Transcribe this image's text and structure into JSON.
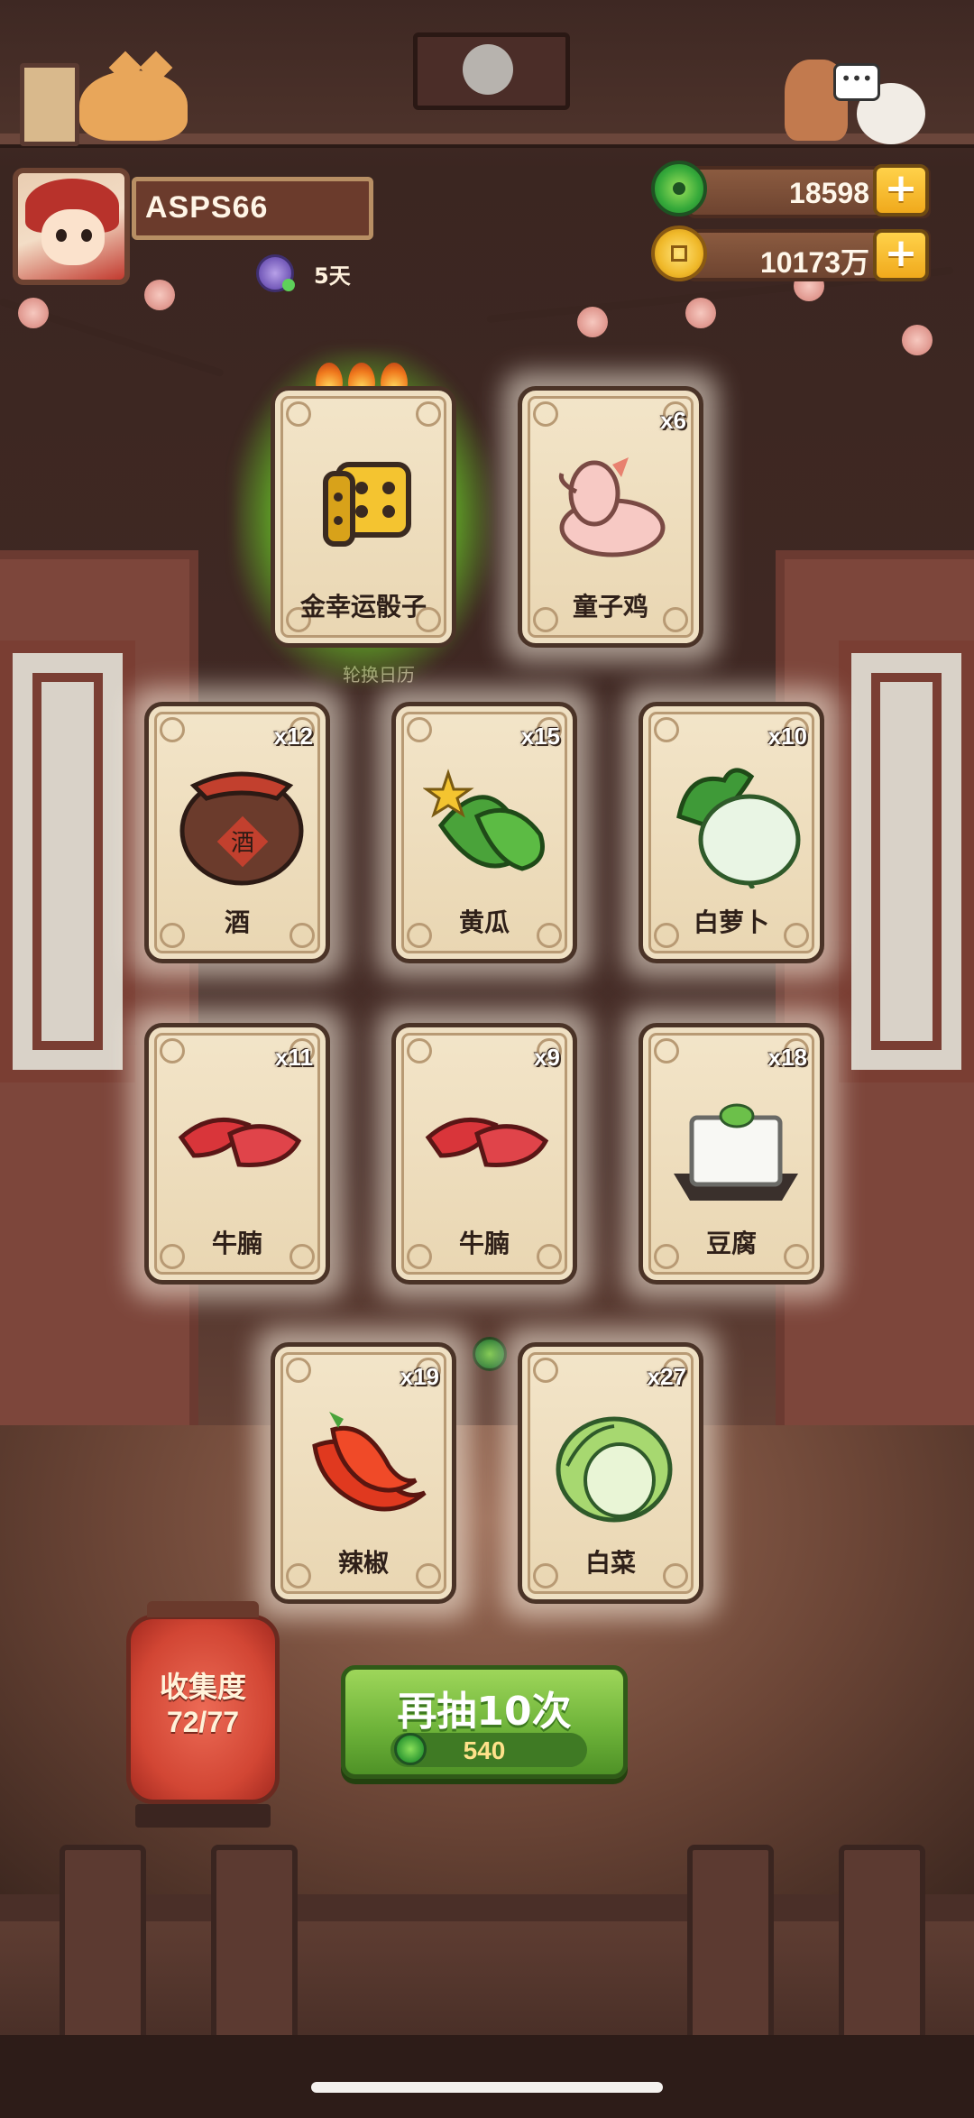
{
  "profile": {
    "name": "ASPS66",
    "days": "5天"
  },
  "currency": {
    "jade": "18598",
    "coins": "10173万"
  },
  "rotate_label": "轮换日历",
  "cards": [
    {
      "name": "金幸运骰子",
      "count": "",
      "icon": "lucky-dice-icon",
      "glow": true
    },
    {
      "name": "童子鸡",
      "count": "x6",
      "icon": "chicken-icon"
    },
    {
      "name": "酒",
      "count": "x12",
      "icon": "wine-jar-icon"
    },
    {
      "name": "黄瓜",
      "count": "x15",
      "icon": "cucumber-icon"
    },
    {
      "name": "白萝卜",
      "count": "x10",
      "icon": "radish-icon"
    },
    {
      "name": "牛腩",
      "count": "x11",
      "icon": "beef-icon"
    },
    {
      "name": "牛腩",
      "count": "x9",
      "icon": "beef-icon"
    },
    {
      "name": "豆腐",
      "count": "x18",
      "icon": "tofu-icon"
    },
    {
      "name": "辣椒",
      "count": "x19",
      "icon": "chili-icon"
    },
    {
      "name": "白菜",
      "count": "x27",
      "icon": "cabbage-icon"
    }
  ],
  "wine_char": "酒",
  "collection": {
    "title": "收集度",
    "count": "72/77"
  },
  "draw_again": {
    "label": "再抽10次",
    "cost": "540"
  },
  "colors": {
    "accent_green": "#6fb43a",
    "card_bg": "#f3e5c9",
    "lantern_red": "#d24634",
    "gold": "#f0a91c"
  }
}
